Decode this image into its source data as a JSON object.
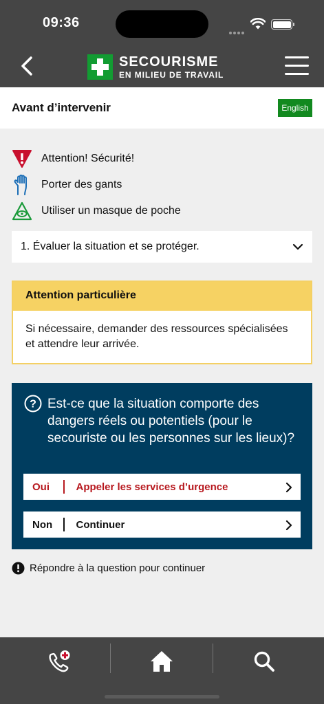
{
  "status_bar": {
    "time": "09:36"
  },
  "header": {
    "logo_title": "SECOURISME",
    "logo_subtitle": "EN MILIEU DE TRAVAIL"
  },
  "title_bar": {
    "title": "Avant d’intervenir",
    "language_button": "English"
  },
  "safety_items": [
    {
      "icon": "warning-icon",
      "label": "Attention! Sécurité!"
    },
    {
      "icon": "glove-icon",
      "label": "Porter des gants"
    },
    {
      "icon": "pocket-mask-icon",
      "label": "Utiliser un masque de poche"
    }
  ],
  "step": {
    "label": "1.  Évaluer la situation et se protéger."
  },
  "attention": {
    "heading": "Attention particulière",
    "body": "Si nécessaire, demander des ressources spécialisées et attendre leur arrivée."
  },
  "question": {
    "text": "Est-ce que la situation comporte des dangers réels ou potentiels (pour le secouriste ou les personnes sur les lieux)?",
    "answers": [
      {
        "key": "Oui",
        "label": "Appeler les services d’urgence"
      },
      {
        "key": "Non",
        "label": "Continuer"
      }
    ]
  },
  "hint": {
    "text": "Répondre à la question pour continuer"
  },
  "colors": {
    "header_bg": "#454545",
    "brand_green": "#129c32",
    "question_bg": "#003d5f",
    "attention_yellow": "#f6d263",
    "emergency_red": "#b7181e"
  },
  "tabs": [
    {
      "icon": "emergency-call-icon"
    },
    {
      "icon": "home-icon"
    },
    {
      "icon": "search-icon"
    }
  ]
}
